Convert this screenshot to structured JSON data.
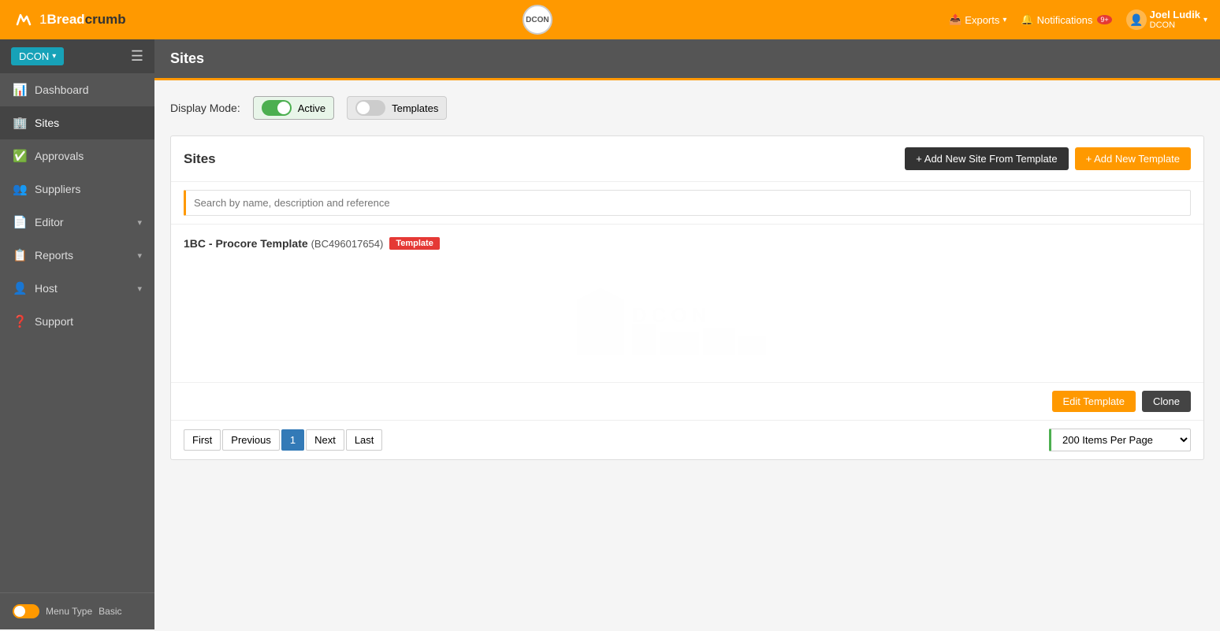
{
  "app": {
    "brand": "1Breadcrumb",
    "brand_one": "1",
    "brand_bread": "Bread",
    "brand_crumb": "crumb"
  },
  "topnav": {
    "org_name": "DCON",
    "exports_label": "Exports",
    "notifications_label": "Notifications",
    "notifications_count": "9+",
    "user_name": "Joel Ludik",
    "user_org": "DCON"
  },
  "sidebar": {
    "org_btn": "DCON",
    "items": [
      {
        "label": "Dashboard",
        "icon": "📊",
        "active": false
      },
      {
        "label": "Sites",
        "icon": "🏢",
        "active": true
      },
      {
        "label": "Approvals",
        "icon": "✅",
        "active": false
      },
      {
        "label": "Suppliers",
        "icon": "👥",
        "active": false
      },
      {
        "label": "Editor",
        "icon": "📄",
        "active": false,
        "has_chevron": true
      },
      {
        "label": "Reports",
        "icon": "📋",
        "active": false,
        "has_chevron": true
      },
      {
        "label": "Host",
        "icon": "👤",
        "active": false,
        "has_chevron": true
      },
      {
        "label": "Support",
        "icon": "❓",
        "active": false
      }
    ],
    "menu_type_label": "Menu Type",
    "menu_type_value": "Basic"
  },
  "page_header": "Sites",
  "display_mode": {
    "label": "Display Mode:",
    "active_label": "Active",
    "templates_label": "Templates"
  },
  "sites_panel": {
    "title": "Sites",
    "add_from_template_label": "+ Add New Site From Template",
    "add_new_template_label": "+ Add New Template",
    "search_placeholder": "Search by name, description and reference",
    "template_item": {
      "name": "1BC - Procore Template",
      "id": "(BC496017654)",
      "badge": "Template"
    },
    "edit_template_label": "Edit Template",
    "clone_label": "Clone"
  },
  "pagination": {
    "first_label": "First",
    "prev_label": "Previous",
    "current_page": "1",
    "next_label": "Next",
    "last_label": "Last",
    "items_per_page": "200 Items Per Page"
  }
}
